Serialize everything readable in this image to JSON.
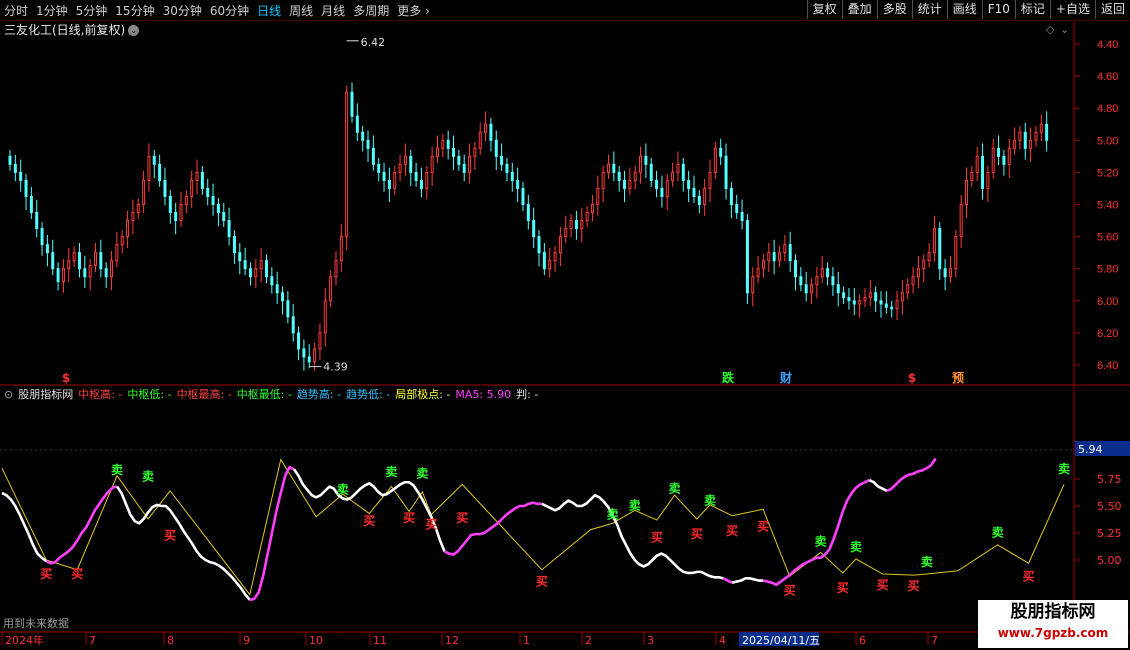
{
  "toolbar": {
    "periods": [
      "分时",
      "1分钟",
      "5分钟",
      "15分钟",
      "30分钟",
      "60分钟",
      "日线",
      "周线",
      "月线",
      "多周期",
      "更多"
    ],
    "active_period": "日线",
    "buttons": [
      "复权",
      "叠加",
      "多股",
      "统计",
      "画线",
      "F10",
      "标记",
      "+自选",
      "返回"
    ]
  },
  "stock_title": "三友化工(日线,前复权)",
  "price_axis": [
    "6.40",
    "6.20",
    "6.00",
    "5.80",
    "5.60",
    "5.40",
    "5.20",
    "5.00",
    "4.80",
    "4.60",
    "4.40"
  ],
  "price_marks": {
    "high": "6.42",
    "low": "4.39"
  },
  "event_markers": [
    {
      "label": "$",
      "color": "#ff3030"
    },
    {
      "label": "跌",
      "color": "#30ff30"
    },
    {
      "label": "财",
      "color": "#40a0ff"
    },
    {
      "label": "$",
      "color": "#ff3030"
    },
    {
      "label": "预",
      "color": "#ff9030"
    }
  ],
  "indicator": {
    "name": "股朋指标网",
    "items": [
      {
        "label": "中枢高:",
        "value": "-",
        "color": "#ff4040"
      },
      {
        "label": "中枢低:",
        "value": "-",
        "color": "#30ff30"
      },
      {
        "label": "中枢最高:",
        "value": "-",
        "color": "#ff4040"
      },
      {
        "label": "中枢最低:",
        "value": "-",
        "color": "#30ff30"
      },
      {
        "label": "趋势高:",
        "value": "-",
        "color": "#30c0ff"
      },
      {
        "label": "趋势低:",
        "value": "-",
        "color": "#30c0ff"
      },
      {
        "label": "局部极点:",
        "value": "-",
        "color": "#ffff30"
      },
      {
        "label": "MA5:",
        "value": "5.90",
        "color": "#ff40ff"
      },
      {
        "label": "判:",
        "value": "-",
        "color": "#e0e0e0"
      }
    ]
  },
  "indicator_axis": [
    "5.75",
    "5.50",
    "5.25",
    "5.00"
  ],
  "current_value": "5.94",
  "buy_label": "买",
  "sell_label": "卖",
  "future_note": "用到未来数据",
  "date_axis": [
    "2024年",
    "7",
    "8",
    "9",
    "10",
    "11",
    "12",
    "1",
    "2",
    "3",
    "4",
    "5",
    "6",
    "7"
  ],
  "cursor_date": "2025/04/11/五",
  "brand": {
    "name": "股朋指标网",
    "url": "www.7gpzb.com"
  },
  "chart_data": {
    "type": "candlestick",
    "title": "三友化工(日线,前复权)",
    "ylim": [
      4.3,
      6.5
    ],
    "ticks": [
      4.4,
      4.6,
      4.8,
      5.0,
      5.2,
      5.4,
      5.6,
      5.8,
      6.0,
      6.2,
      6.4
    ],
    "high_label": {
      "index": 63,
      "value": 6.42
    },
    "low_label": {
      "index": 56,
      "value": 4.39
    },
    "close": [
      5.65,
      5.6,
      5.55,
      5.45,
      5.35,
      5.25,
      5.15,
      5.1,
      5.0,
      4.92,
      5.0,
      5.05,
      5.1,
      5.0,
      4.95,
      5.02,
      5.1,
      5.0,
      4.95,
      5.05,
      5.15,
      5.2,
      5.3,
      5.35,
      5.4,
      5.55,
      5.7,
      5.65,
      5.55,
      5.45,
      5.35,
      5.3,
      5.4,
      5.45,
      5.55,
      5.6,
      5.5,
      5.45,
      5.4,
      5.35,
      5.3,
      5.2,
      5.1,
      5.05,
      5.0,
      4.95,
      5.0,
      5.05,
      4.95,
      4.9,
      4.85,
      4.8,
      4.7,
      4.6,
      4.5,
      4.45,
      4.42,
      4.5,
      4.6,
      4.8,
      4.95,
      5.05,
      5.2,
      6.1,
      5.95,
      5.85,
      5.8,
      5.75,
      5.65,
      5.6,
      5.55,
      5.5,
      5.6,
      5.65,
      5.7,
      5.6,
      5.55,
      5.5,
      5.6,
      5.7,
      5.75,
      5.8,
      5.75,
      5.7,
      5.65,
      5.6,
      5.7,
      5.75,
      5.85,
      5.9,
      5.8,
      5.7,
      5.65,
      5.6,
      5.55,
      5.5,
      5.4,
      5.3,
      5.2,
      5.1,
      5.0,
      5.05,
      5.1,
      5.2,
      5.25,
      5.3,
      5.25,
      5.3,
      5.35,
      5.4,
      5.5,
      5.6,
      5.65,
      5.6,
      5.55,
      5.5,
      5.55,
      5.6,
      5.7,
      5.65,
      5.55,
      5.5,
      5.45,
      5.55,
      5.6,
      5.65,
      5.55,
      5.5,
      5.45,
      5.4,
      5.5,
      5.6,
      5.75,
      5.7,
      5.5,
      5.4,
      5.35,
      5.3,
      4.85,
      4.95,
      5.0,
      5.05,
      5.1,
      5.05,
      5.1,
      5.15,
      5.05,
      4.95,
      4.9,
      4.85,
      4.9,
      4.95,
      5.0,
      4.95,
      4.9,
      4.85,
      4.82,
      4.8,
      4.78,
      4.8,
      4.82,
      4.85,
      4.8,
      4.78,
      4.76,
      4.75,
      4.8,
      4.85,
      4.9,
      4.95,
      5.0,
      5.05,
      5.1,
      5.25,
      5.0,
      4.95,
      5.0,
      5.2,
      5.4,
      5.55,
      5.6,
      5.7,
      5.5,
      5.6,
      5.75,
      5.7,
      5.65,
      5.75,
      5.8,
      5.85,
      5.75,
      5.8,
      5.85,
      5.9,
      5.8
    ]
  },
  "indicator_data": {
    "type": "line",
    "ylim": [
      4.7,
      5.93
    ],
    "ticks": [
      5.0,
      5.25,
      5.5,
      5.75
    ],
    "ma5_segments": [
      {
        "start": 0,
        "end": 10,
        "values": [
          5.62,
          5.6,
          5.56,
          5.5,
          5.42,
          5.33,
          5.24,
          5.14,
          5.06,
          5.02,
          4.99
        ],
        "color": "#ffffff"
      },
      {
        "start": 10,
        "end": 26,
        "values": [
          4.99,
          4.97,
          4.98,
          5.02,
          5.05,
          5.08,
          5.12,
          5.18,
          5.25,
          5.3,
          5.38,
          5.46,
          5.52,
          5.58,
          5.63,
          5.67,
          5.68
        ],
        "color": "#ff40ff"
      },
      {
        "start": 26,
        "end": 56,
        "values": [
          5.68,
          5.62,
          5.52,
          5.42,
          5.36,
          5.34,
          5.38,
          5.44,
          5.49,
          5.51,
          5.5,
          5.5,
          5.46,
          5.4,
          5.34,
          5.27,
          5.21,
          5.15,
          5.08,
          5.03,
          5.0,
          4.98,
          4.97,
          4.95,
          4.92,
          4.88,
          4.84,
          4.79,
          4.74,
          4.68,
          4.63
        ],
        "color": "#ffffff"
      },
      {
        "start": 56,
        "end": 66,
        "values": [
          4.63,
          4.64,
          4.7,
          4.85,
          5.05,
          5.25,
          5.45,
          5.62,
          5.78,
          5.86,
          5.84
        ],
        "color": "#ff40ff"
      },
      {
        "start": 66,
        "end": 100,
        "values": [
          5.84,
          5.78,
          5.7,
          5.65,
          5.6,
          5.58,
          5.6,
          5.64,
          5.68,
          5.66,
          5.6,
          5.57,
          5.56,
          5.58,
          5.62,
          5.66,
          5.69,
          5.71,
          5.68,
          5.63,
          5.6,
          5.61,
          5.64,
          5.67,
          5.7,
          5.72,
          5.72,
          5.69,
          5.63,
          5.56,
          5.48,
          5.4,
          5.3,
          5.18,
          5.08
        ],
        "color": "#ffffff"
      },
      {
        "start": 100,
        "end": 122,
        "values": [
          5.08,
          5.06,
          5.05,
          5.08,
          5.13,
          5.18,
          5.23,
          5.24,
          5.24,
          5.25,
          5.28,
          5.31,
          5.34,
          5.38,
          5.42,
          5.45,
          5.48,
          5.5,
          5.5,
          5.52,
          5.53,
          5.52,
          5.52
        ],
        "color": "#ff40ff"
      },
      {
        "start": 122,
        "end": 163,
        "values": [
          5.52,
          5.5,
          5.48,
          5.46,
          5.48,
          5.52,
          5.55,
          5.53,
          5.5,
          5.5,
          5.52,
          5.56,
          5.6,
          5.58,
          5.54,
          5.49,
          5.41,
          5.33,
          5.22,
          5.14,
          5.06,
          5.0,
          4.96,
          4.94,
          4.96,
          5.0,
          5.04,
          5.06,
          5.04,
          5.0,
          4.96,
          4.92,
          4.89,
          4.88,
          4.88,
          4.89,
          4.89,
          4.87,
          4.85,
          4.84,
          4.84,
          4.83
        ],
        "color": "#ffffff"
      },
      {
        "start": 163,
        "end": 165,
        "values": [
          4.83,
          4.81,
          4.79
        ],
        "color": "#ff40ff"
      },
      {
        "start": 165,
        "end": 172,
        "values": [
          4.79,
          4.8,
          4.81,
          4.83,
          4.83,
          4.82,
          4.81,
          4.81
        ],
        "color": "#ffffff"
      },
      {
        "start": 172,
        "end": 196,
        "values": [
          4.81,
          4.8,
          4.79,
          4.77,
          4.8,
          4.83,
          4.86,
          4.9,
          4.93,
          4.96,
          4.98,
          5.0,
          5.02,
          5.02,
          5.05,
          5.1,
          5.2,
          5.32,
          5.45,
          5.55,
          5.62,
          5.67,
          5.7,
          5.72,
          5.74
        ],
        "color": "#ff40ff"
      },
      {
        "start": 196,
        "end": 200,
        "values": [
          5.74,
          5.72,
          5.68,
          5.66,
          5.64
        ],
        "color": "#ffffff"
      },
      {
        "start": 200,
        "end": 211,
        "values": [
          5.64,
          5.66,
          5.7,
          5.74,
          5.77,
          5.79,
          5.8,
          5.82,
          5.83,
          5.85,
          5.88,
          5.94
        ],
        "color": "#ff40ff"
      }
    ],
    "pivot_line": [
      [
        0,
        5.85
      ],
      [
        10,
        5.0
      ],
      [
        17,
        4.91
      ],
      [
        26,
        5.78
      ],
      [
        33,
        5.38
      ],
      [
        38,
        5.64
      ],
      [
        56,
        4.68
      ],
      [
        63,
        5.93
      ],
      [
        71,
        5.4
      ],
      [
        77,
        5.61
      ],
      [
        83,
        5.43
      ],
      [
        88,
        5.68
      ],
      [
        92,
        5.45
      ],
      [
        95,
        5.63
      ],
      [
        97,
        5.42
      ],
      [
        104,
        5.7
      ],
      [
        122,
        4.91
      ],
      [
        133,
        5.28
      ],
      [
        138,
        5.34
      ],
      [
        143,
        5.46
      ],
      [
        148,
        5.37
      ],
      [
        152,
        5.6
      ],
      [
        157,
        5.38
      ],
      [
        160,
        5.51
      ],
      [
        165,
        5.41
      ],
      [
        172,
        5.47
      ],
      [
        178,
        4.85
      ],
      [
        185,
        5.07
      ],
      [
        190,
        4.88
      ],
      [
        193,
        5.01
      ],
      [
        199,
        4.87
      ],
      [
        206,
        4.86
      ],
      [
        209,
        4.87
      ],
      [
        216,
        4.9
      ],
      [
        225,
        5.14
      ],
      [
        232,
        4.97
      ],
      [
        240,
        5.7
      ]
    ],
    "buy_points": [
      [
        10,
        4.98
      ],
      [
        17,
        4.98
      ],
      [
        38,
        5.34
      ],
      [
        83,
        5.47
      ],
      [
        92,
        5.5
      ],
      [
        97,
        5.44
      ],
      [
        104,
        5.5
      ],
      [
        122,
        4.91
      ],
      [
        148,
        5.32
      ],
      [
        157,
        5.35
      ],
      [
        165,
        5.38
      ],
      [
        172,
        5.42
      ],
      [
        178,
        4.83
      ],
      [
        190,
        4.85
      ],
      [
        199,
        4.88
      ],
      [
        206,
        4.87
      ],
      [
        232,
        4.96
      ]
    ],
    "sell_points": [
      [
        26,
        5.74
      ],
      [
        33,
        5.68
      ],
      [
        77,
        5.56
      ],
      [
        88,
        5.72
      ],
      [
        95,
        5.71
      ],
      [
        138,
        5.33
      ],
      [
        143,
        5.41
      ],
      [
        152,
        5.57
      ],
      [
        160,
        5.46
      ],
      [
        185,
        5.08
      ],
      [
        193,
        5.03
      ],
      [
        209,
        4.89
      ],
      [
        225,
        5.16
      ],
      [
        240,
        5.75
      ]
    ]
  }
}
